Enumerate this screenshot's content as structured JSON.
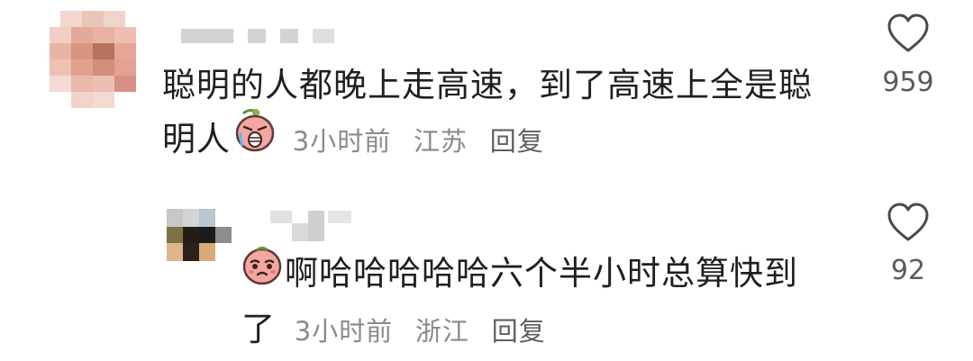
{
  "comments": [
    {
      "text_line1": "聪明的人都晚上走高速，到了高速上全是聪",
      "text_line2": "明人",
      "time": "3小时前",
      "location": "江苏",
      "reply_label": "回复",
      "likes": "959",
      "emoji": "crying-face-emoji"
    },
    {
      "text_line1": "啊哈哈哈哈哈六个半小时总算快到",
      "text_line2": "了",
      "time": "3小时前",
      "location": "浙江",
      "reply_label": "回复",
      "likes": "92",
      "emoji": "teary-face-emoji"
    }
  ],
  "icons": {
    "like": "heart-outline-icon"
  },
  "colors": {
    "text": "#1f1f1f",
    "meta": "#8a8a8a",
    "placeholder": "#d3d3d3"
  }
}
